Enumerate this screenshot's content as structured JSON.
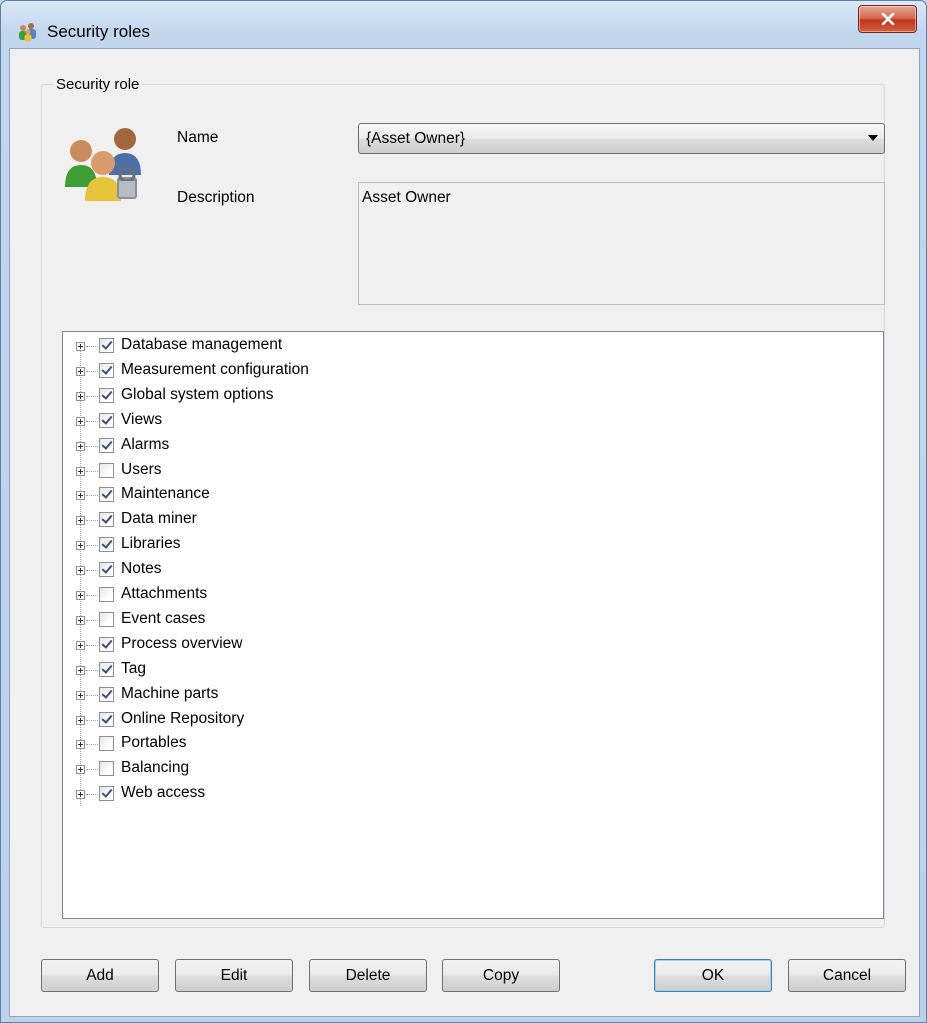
{
  "window": {
    "title": "Security roles"
  },
  "group": {
    "title": "Security role"
  },
  "form": {
    "name_label": "Name",
    "name_value": "{Asset Owner}",
    "description_label": "Description",
    "description_value": "Asset Owner"
  },
  "tree": {
    "items": [
      {
        "label": "Database management",
        "checked": true
      },
      {
        "label": "Measurement configuration",
        "checked": true
      },
      {
        "label": "Global system options",
        "checked": true
      },
      {
        "label": "Views",
        "checked": true
      },
      {
        "label": "Alarms",
        "checked": true
      },
      {
        "label": "Users",
        "checked": false
      },
      {
        "label": "Maintenance",
        "checked": true
      },
      {
        "label": "Data miner",
        "checked": true
      },
      {
        "label": "Libraries",
        "checked": true
      },
      {
        "label": "Notes",
        "checked": true
      },
      {
        "label": "Attachments",
        "checked": false
      },
      {
        "label": "Event cases",
        "checked": false
      },
      {
        "label": "Process overview",
        "checked": true
      },
      {
        "label": "Tag",
        "checked": true
      },
      {
        "label": "Machine parts",
        "checked": true
      },
      {
        "label": "Online Repository",
        "checked": true
      },
      {
        "label": "Portables",
        "checked": false
      },
      {
        "label": "Balancing",
        "checked": false
      },
      {
        "label": "Web access",
        "checked": true
      }
    ]
  },
  "buttons": {
    "add": "Add",
    "edit": "Edit",
    "delete": "Delete",
    "copy": "Copy",
    "ok": "OK",
    "cancel": "Cancel"
  },
  "icons": {
    "title": "users-icon",
    "role": "security-role-users-icon",
    "close": "close-icon"
  },
  "colors": {
    "close_button": "#c2351b",
    "check_mark": "#3a4f7a",
    "default_button_border": "#3c7fb1"
  }
}
